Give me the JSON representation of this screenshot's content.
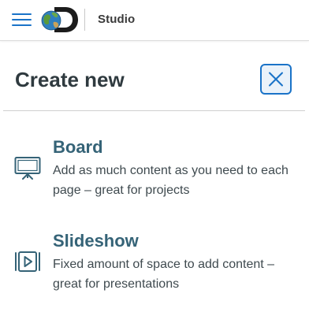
{
  "header": {
    "app_label": "Studio",
    "brand_color": "#1a73c8",
    "icons": {
      "menu": "hamburger-menu-icon",
      "logo": "discovery-globe-logo"
    }
  },
  "panel": {
    "title": "Create new",
    "close_icon": "close-icon",
    "options": [
      {
        "title": "Board",
        "description": "Add as much content as you need to each page – great for projects",
        "icon": "presentation-board-icon"
      },
      {
        "title": "Slideshow",
        "description": "Fixed amount of space to add content – great for presentations",
        "icon": "slideshow-play-icon"
      }
    ]
  }
}
